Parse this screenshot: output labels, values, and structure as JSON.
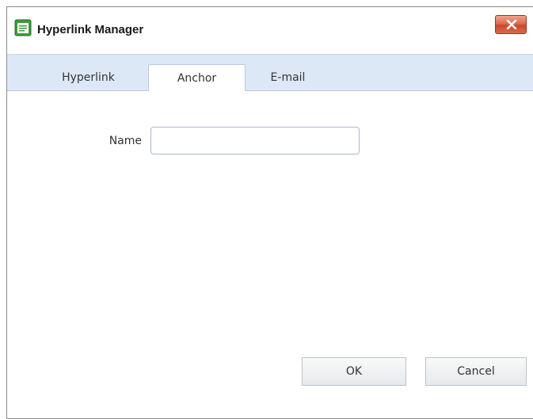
{
  "dialog": {
    "title": "Hyperlink Manager",
    "close_icon": "close-x-icon",
    "app_icon": "document-icon",
    "close_color": "#d9694d"
  },
  "tabs": [
    {
      "label": "Hyperlink",
      "active": false
    },
    {
      "label": "Anchor",
      "active": true
    },
    {
      "label": "E-mail",
      "active": false
    }
  ],
  "form": {
    "name_label": "Name",
    "name_value": "",
    "name_placeholder": ""
  },
  "buttons": {
    "ok_label": "OK",
    "cancel_label": "Cancel"
  }
}
